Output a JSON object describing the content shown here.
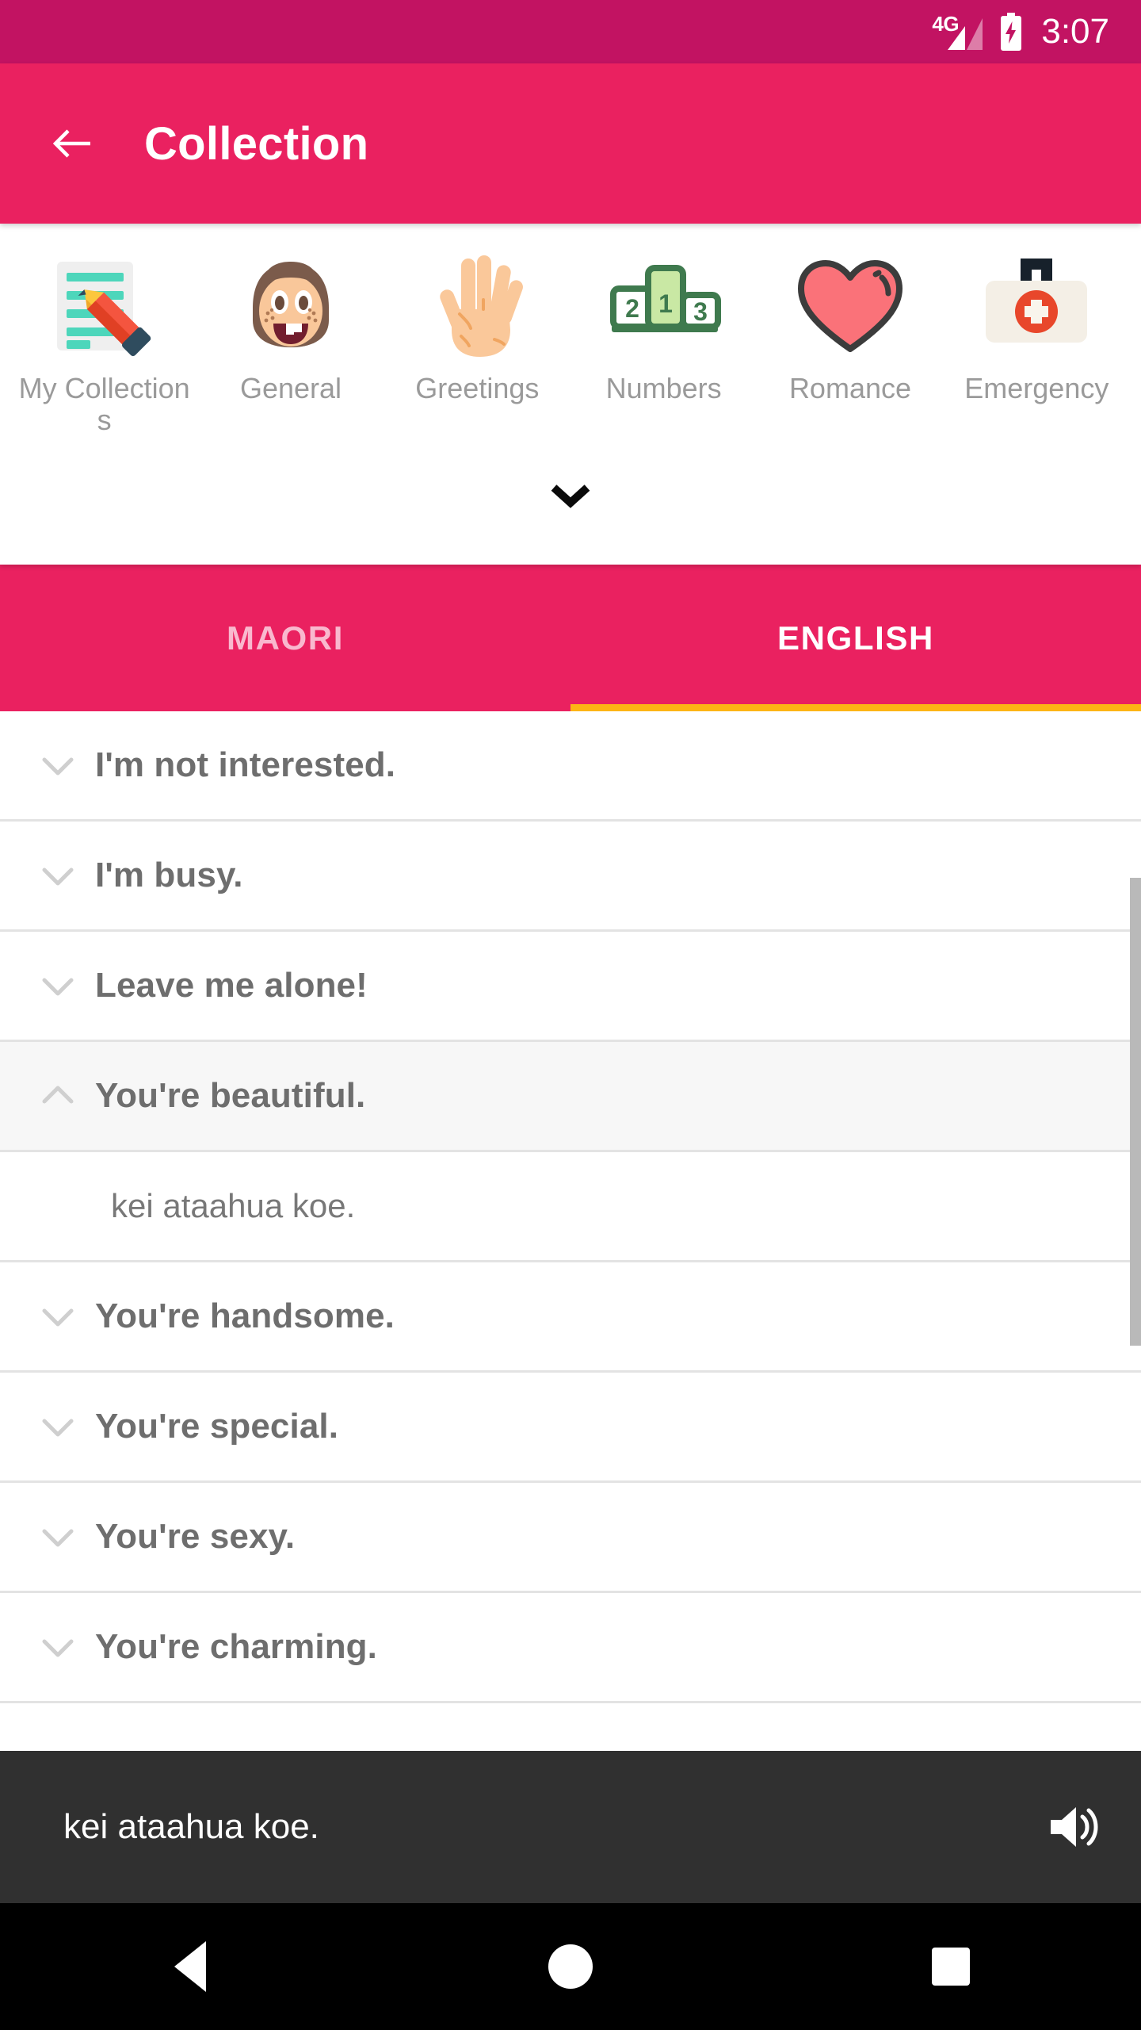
{
  "status_bar": {
    "network": "4G",
    "time": "3:07",
    "battery_icon": "battery-charging-icon",
    "signal_icon": "signal-bars-icon"
  },
  "app_bar": {
    "back_icon": "back-arrow-icon",
    "title": "Collection"
  },
  "categories": {
    "expander_icon": "chevron-down-icon",
    "items": [
      {
        "label": "My Collections",
        "icon": "notepad-pencil-icon"
      },
      {
        "label": "General",
        "icon": "face-emoji-icon"
      },
      {
        "label": "Greetings",
        "icon": "raised-hand-icon"
      },
      {
        "label": "Numbers",
        "icon": "podium-icon"
      },
      {
        "label": "Romance",
        "icon": "heart-icon"
      },
      {
        "label": "Emergency",
        "icon": "first-aid-kit-icon"
      }
    ]
  },
  "tabs": {
    "items": [
      {
        "label": "MAORI",
        "active": false
      },
      {
        "label": "ENGLISH",
        "active": true
      }
    ],
    "indicator_color": "#FDB515"
  },
  "phrase_list": [
    {
      "text": "I'm not interested.",
      "expanded": false,
      "chevron": "chevron-down-icon"
    },
    {
      "text": "I'm busy.",
      "expanded": false,
      "chevron": "chevron-down-icon"
    },
    {
      "text": "Leave me alone!",
      "expanded": false,
      "chevron": "chevron-down-icon"
    },
    {
      "text": "You're beautiful.",
      "expanded": true,
      "chevron": "chevron-up-icon",
      "translation": "kei ataahua koe."
    },
    {
      "text": "You're handsome.",
      "expanded": false,
      "chevron": "chevron-down-icon"
    },
    {
      "text": "You're special.",
      "expanded": false,
      "chevron": "chevron-down-icon"
    },
    {
      "text": "You're sexy.",
      "expanded": false,
      "chevron": "chevron-down-icon"
    },
    {
      "text": "You're charming.",
      "expanded": false,
      "chevron": "chevron-down-icon"
    }
  ],
  "player": {
    "text": "kei ataahua koe.",
    "speaker_icon": "speaker-volume-icon"
  },
  "nav_bar": {
    "back": "nav-back-triangle-icon",
    "home": "nav-home-circle-icon",
    "recents": "nav-recents-square-icon"
  },
  "colors": {
    "status_bar": "#C21362",
    "app_bar": "#EA2160",
    "tab_indicator": "#FDB515",
    "player_bar": "#303030",
    "nav_bar": "#000000"
  }
}
